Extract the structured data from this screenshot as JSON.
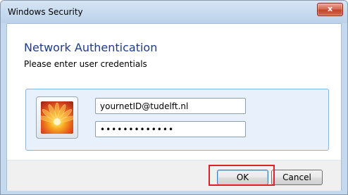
{
  "window": {
    "title": "Windows Security",
    "close_label": "x"
  },
  "dialog": {
    "heading": "Network Authentication",
    "subheading": "Please enter user credentials"
  },
  "credentials": {
    "username_value": "yournetID@tudelft.nl",
    "password_value": "•••••••••••••"
  },
  "buttons": {
    "ok_label": "OK",
    "cancel_label": "Cancel"
  },
  "colors": {
    "heading": "#1e3c8c",
    "highlight": "#e2202a",
    "titlebar": "#c8dbef"
  }
}
